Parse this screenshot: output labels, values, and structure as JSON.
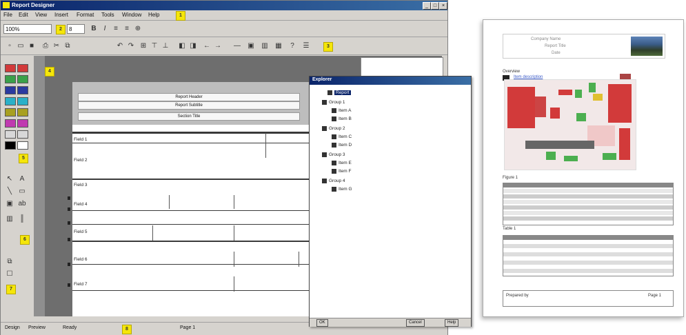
{
  "designer": {
    "title": "Report Designer",
    "menu": [
      "File",
      "Edit",
      "View",
      "Insert",
      "Format",
      "Tools",
      "Window",
      "Help"
    ],
    "zoom": "100%",
    "font_size": "8",
    "page_header_lines": [
      "Report Header",
      "Report Subtitle",
      "Section Title"
    ],
    "fields": [
      "Field 1",
      "Field 2",
      "Field 3",
      "Field 4",
      "Field 5",
      "Field 6",
      "Field 7"
    ],
    "status_left": "Ready",
    "status_right": "Page 1",
    "tab_design": "Design",
    "tab_preview": "Preview",
    "markers": [
      "1",
      "2",
      "3",
      "4",
      "5",
      "6",
      "7",
      "8",
      "9"
    ]
  },
  "explorer": {
    "title": "Explorer",
    "items": [
      "Report",
      "Group 1",
      "Item A",
      "Item B",
      "Group 2",
      "Item C",
      "Item D",
      "Group 3",
      "Item E",
      "Item F",
      "Group 4",
      "Item G"
    ],
    "btn_a": "OK",
    "btn_b": "Cancel",
    "btn_c": "Help"
  },
  "report": {
    "header_lines": [
      "Company Name",
      "Report Title",
      "Date"
    ],
    "section_title": "Overview",
    "link_text": "Item description",
    "caption1": "Figure 1",
    "caption2": "Table 1",
    "footer_left": "Prepared by",
    "footer_right": "Page 1"
  },
  "colors": {
    "titlebar": "#0a246a",
    "marker": "#f5e60a",
    "diagram_red": "#d23a3a",
    "diagram_green": "#4caf50"
  },
  "icons": [
    "new-icon",
    "open-icon",
    "save-icon",
    "print-icon",
    "bold-icon",
    "italic-icon",
    "align-left-icon",
    "align-center-icon",
    "zoom-icon",
    "pointer-icon",
    "text-tool-icon",
    "line-tool-icon",
    "rectangle-tool-icon",
    "picture-tool-icon",
    "folder-icon",
    "document-icon"
  ]
}
